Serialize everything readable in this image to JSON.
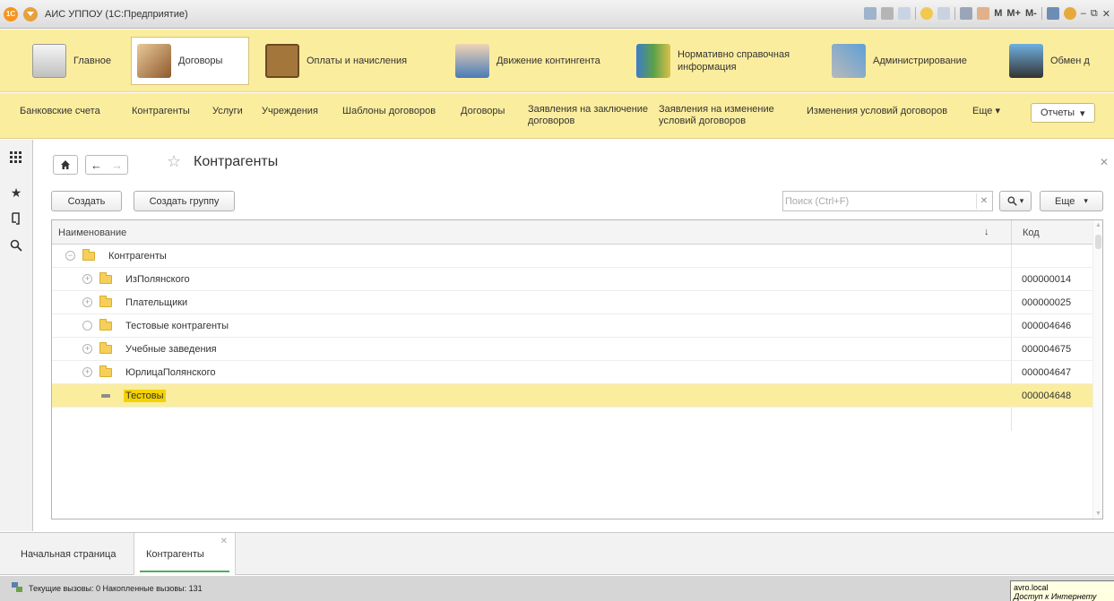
{
  "window": {
    "title": "АИС УППОУ (1С:Предприятие)",
    "memory_buttons": [
      "M",
      "M+",
      "M-"
    ]
  },
  "sections": [
    {
      "label": "Главное",
      "icon": "home-section-icon"
    },
    {
      "label": "Договоры",
      "icon": "contract-signing-icon",
      "active": true
    },
    {
      "label": "Оплаты и начисления",
      "icon": "abacus-icon"
    },
    {
      "label": "Движение контингента",
      "icon": "person-card-icon"
    },
    {
      "label": "Нормативно справочная информация",
      "icon": "binders-icon"
    },
    {
      "label": "Администрирование",
      "icon": "tools-icon"
    },
    {
      "label": "Обмен д",
      "icon": "exchange-icon"
    }
  ],
  "nav": {
    "items": [
      "Банковские счета",
      "Контрагенты",
      "Услуги",
      "Учреждения",
      "Шаблоны договоров",
      "Договоры",
      "Заявления на заключение договоров",
      "Заявления на изменение условий договоров",
      "Изменения условий договоров"
    ],
    "more": "Еще",
    "reports": "Отчеты"
  },
  "form": {
    "title": "Контрагенты",
    "create_label": "Создать",
    "create_group_label": "Создать группу",
    "search_placeholder": "Поиск (Ctrl+F)",
    "more_label": "Еще"
  },
  "table": {
    "columns": {
      "name": "Наименование",
      "code": "Код",
      "sort_indicator": "↓"
    },
    "rows": [
      {
        "name": "Контрагенты",
        "code": "",
        "level": 0,
        "type": "folder",
        "expander": "minus"
      },
      {
        "name": "ИзПолянского",
        "code": "000000014",
        "level": 1,
        "type": "folder",
        "expander": "plus"
      },
      {
        "name": "Плательщики",
        "code": "000000025",
        "level": 1,
        "type": "folder",
        "expander": "plus"
      },
      {
        "name": "Тестовые контрагенты",
        "code": "000004646",
        "level": 1,
        "type": "folder",
        "expander": "empty"
      },
      {
        "name": "Учебные заведения",
        "code": "000004675",
        "level": 1,
        "type": "folder",
        "expander": "plus"
      },
      {
        "name": "ЮрлицаПолянского",
        "code": "000004647",
        "level": 1,
        "type": "folder",
        "expander": "plus"
      },
      {
        "name": "Тестовы",
        "code": "000004648",
        "level": 2,
        "type": "item",
        "selected": true
      }
    ]
  },
  "tabs": [
    {
      "label": "Начальная страница"
    },
    {
      "label": "Контрагенты",
      "active": true
    }
  ],
  "status": {
    "calls_text": "Текущие вызовы: 0   Накопленные вызовы: 131",
    "tooltip_line1": "avro.local",
    "tooltip_line2": "Доступ к Интернету"
  },
  "colors": {
    "section_bar": "#fbed9e",
    "selected_row": "#fbed9e",
    "selected_text_bg": "#f5d200",
    "active_tab_underline": "#4fae5b"
  }
}
